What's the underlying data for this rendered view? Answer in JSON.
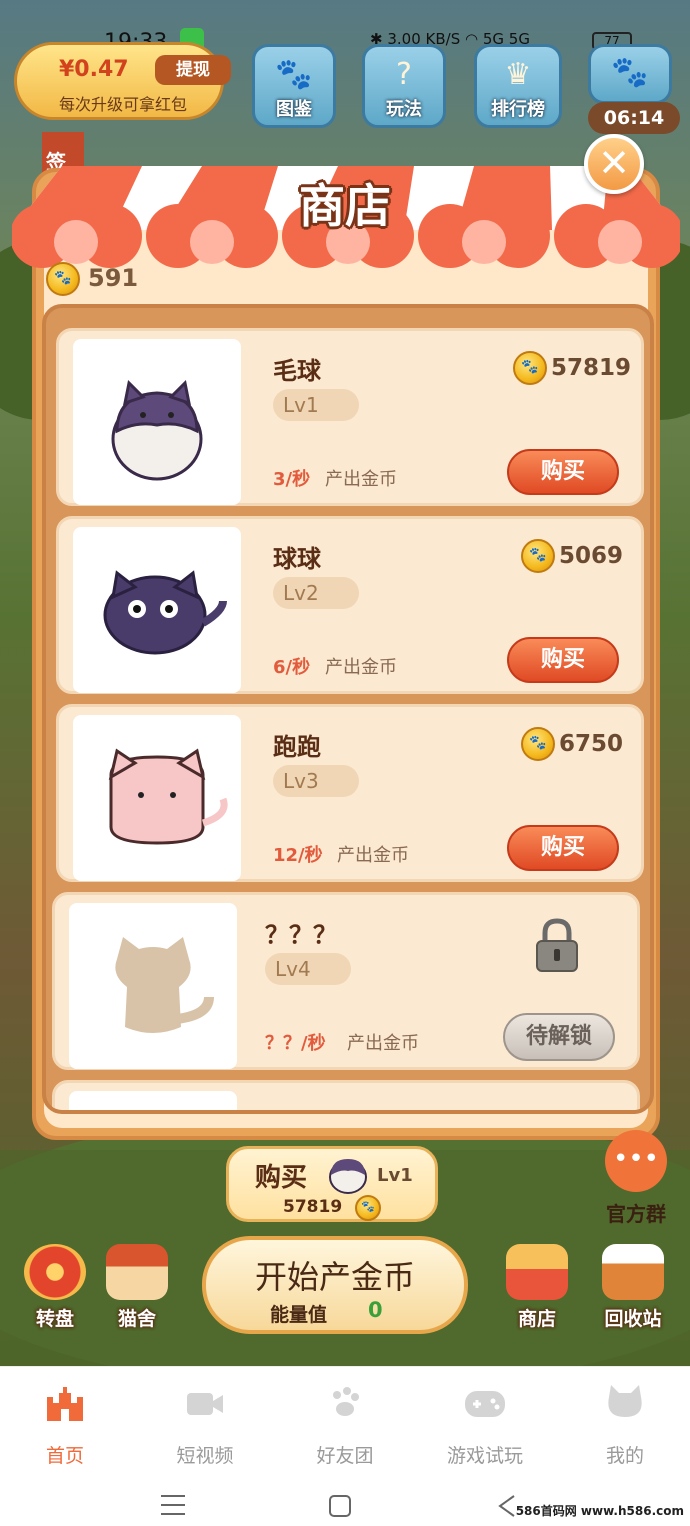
{
  "status_bar": {
    "time": "19:33",
    "network_speed": "3.00 KB/S",
    "signal": "5G 5G",
    "battery": "77"
  },
  "hud": {
    "money_amount": "¥0.47",
    "withdraw_label": "提现",
    "money_note": "每次升级可拿红包",
    "top_icons": [
      "图鉴",
      "玩法",
      "排行榜"
    ],
    "timer": "06:14",
    "signin_label": "签到"
  },
  "shop": {
    "title": "商店",
    "coin_balance": "591",
    "rate_label": "产出金币",
    "items": [
      {
        "name": "毛球",
        "level": "Lv1",
        "price": "57819",
        "rate": "3/秒",
        "button": "购买",
        "color": "#ffffff",
        "head": "#5e4a7a"
      },
      {
        "name": "球球",
        "level": "Lv2",
        "price": "5069",
        "rate": "6/秒",
        "button": "购买",
        "color": "#4a3c6a",
        "head": "#4a3c6a"
      },
      {
        "name": "跑跑",
        "level": "Lv3",
        "price": "6750",
        "rate": "12/秒",
        "button": "购买",
        "color": "#f7c6c6",
        "head": "#f7c6c6"
      },
      {
        "name": "？？？",
        "level": "Lv4",
        "price": "",
        "rate": "？？/秒",
        "button": "待解锁",
        "color": "#d8c3a8",
        "head": "#d8c3a8"
      },
      {
        "name": "？？？",
        "level": "",
        "price": "",
        "rate": "",
        "button": "",
        "color": "#d8c3a8",
        "head": "#d8c3a8"
      }
    ]
  },
  "bottom_hud": {
    "buy_label": "购买",
    "buy_level": "Lv1",
    "buy_price": "57819",
    "official_group": "官方群",
    "start_label": "开始产金币",
    "energy_label": "能量值",
    "energy_value": "0",
    "left_buttons": [
      "转盘",
      "猫舍"
    ],
    "right_buttons": [
      "商店",
      "回收站"
    ]
  },
  "bottom_nav": {
    "items": [
      "首页",
      "短视频",
      "好友团",
      "游戏试玩",
      "我的"
    ],
    "active_index": 0,
    "accent": "#f06a3a"
  },
  "watermark": "586首码网 www.h586.com"
}
